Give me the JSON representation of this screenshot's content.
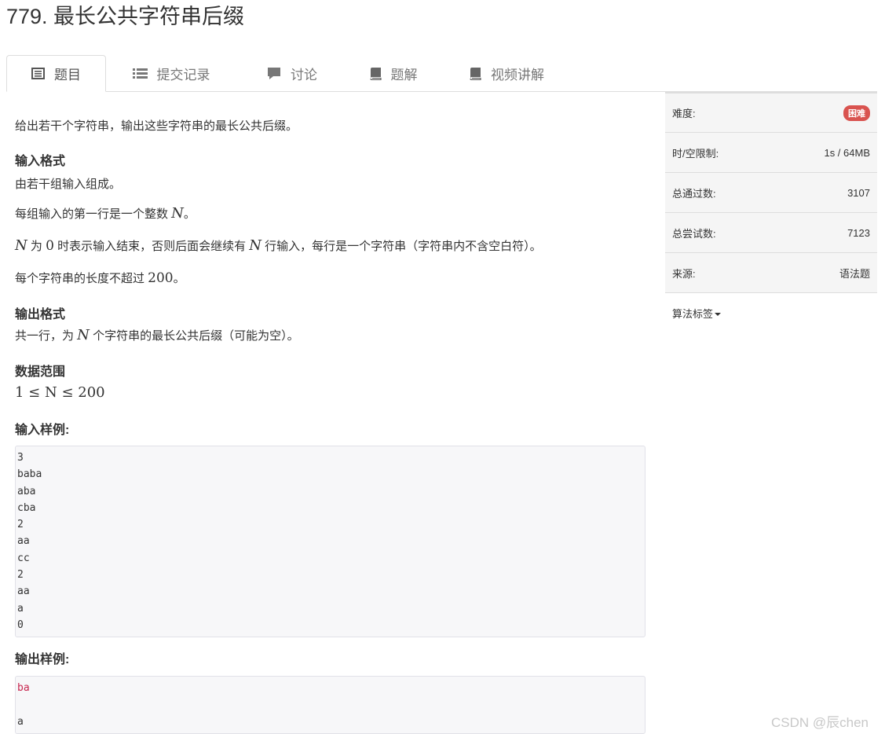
{
  "problem": {
    "title": "779. 最长公共字符串后缀"
  },
  "tabs": [
    {
      "label": "题目",
      "icon": "list-icon",
      "active": true
    },
    {
      "label": "提交记录",
      "icon": "list-lines-icon",
      "active": false
    },
    {
      "label": "讨论",
      "icon": "comment-icon",
      "active": false
    },
    {
      "label": "题解",
      "icon": "book-icon",
      "active": false
    },
    {
      "label": "视频讲解",
      "icon": "book-icon",
      "active": false
    }
  ],
  "description": {
    "intro": "给出若干个字符串，输出这些字符串的最长公共后缀。",
    "input_heading": "输入格式",
    "input_line1": "由若干组输入组成。",
    "input_line2_prefix": "每组输入的第一行是一个整数 ",
    "var_n": "N",
    "input_line2_suffix": "。",
    "input_line3_part1": " 为 ",
    "zero": "0",
    "input_line3_part2": " 时表示输入结束，否则后面会继续有 ",
    "input_line3_part3": " 行输入，每行是一个字符串（字符串内不含空白符）。",
    "input_line4_prefix": "每个字符串的长度不超过 ",
    "max_len": "200",
    "input_line4_suffix": "。",
    "output_heading": "输出格式",
    "output_line_prefix": "共一行，为 ",
    "output_line_suffix": " 个字符串的最长公共后缀（可能为空）。",
    "range_heading": "数据范围",
    "range_text": "1 ≤ N ≤ 200",
    "sample_input_heading": "输入样例:",
    "sample_input": [
      "3",
      "baba",
      "aba",
      "cba",
      "2",
      "aa",
      "cc",
      "2",
      "aa",
      "a",
      "0"
    ],
    "sample_output_heading": "输出样例:",
    "sample_output": [
      "ba",
      "",
      "a"
    ]
  },
  "sidebar": {
    "difficulty_label": "难度:",
    "difficulty_value": "困难",
    "limit_label": "时/空限制:",
    "limit_value": "1s / 64MB",
    "passed_label": "总通过数:",
    "passed_value": "3107",
    "attempts_label": "总尝试数:",
    "attempts_value": "7123",
    "source_label": "来源:",
    "source_value": "语法题",
    "tags_label": "算法标签"
  },
  "colors": {
    "badge": "#d9534f",
    "code_highlight": "#c7254e"
  },
  "watermark": "CSDN @辰chen"
}
